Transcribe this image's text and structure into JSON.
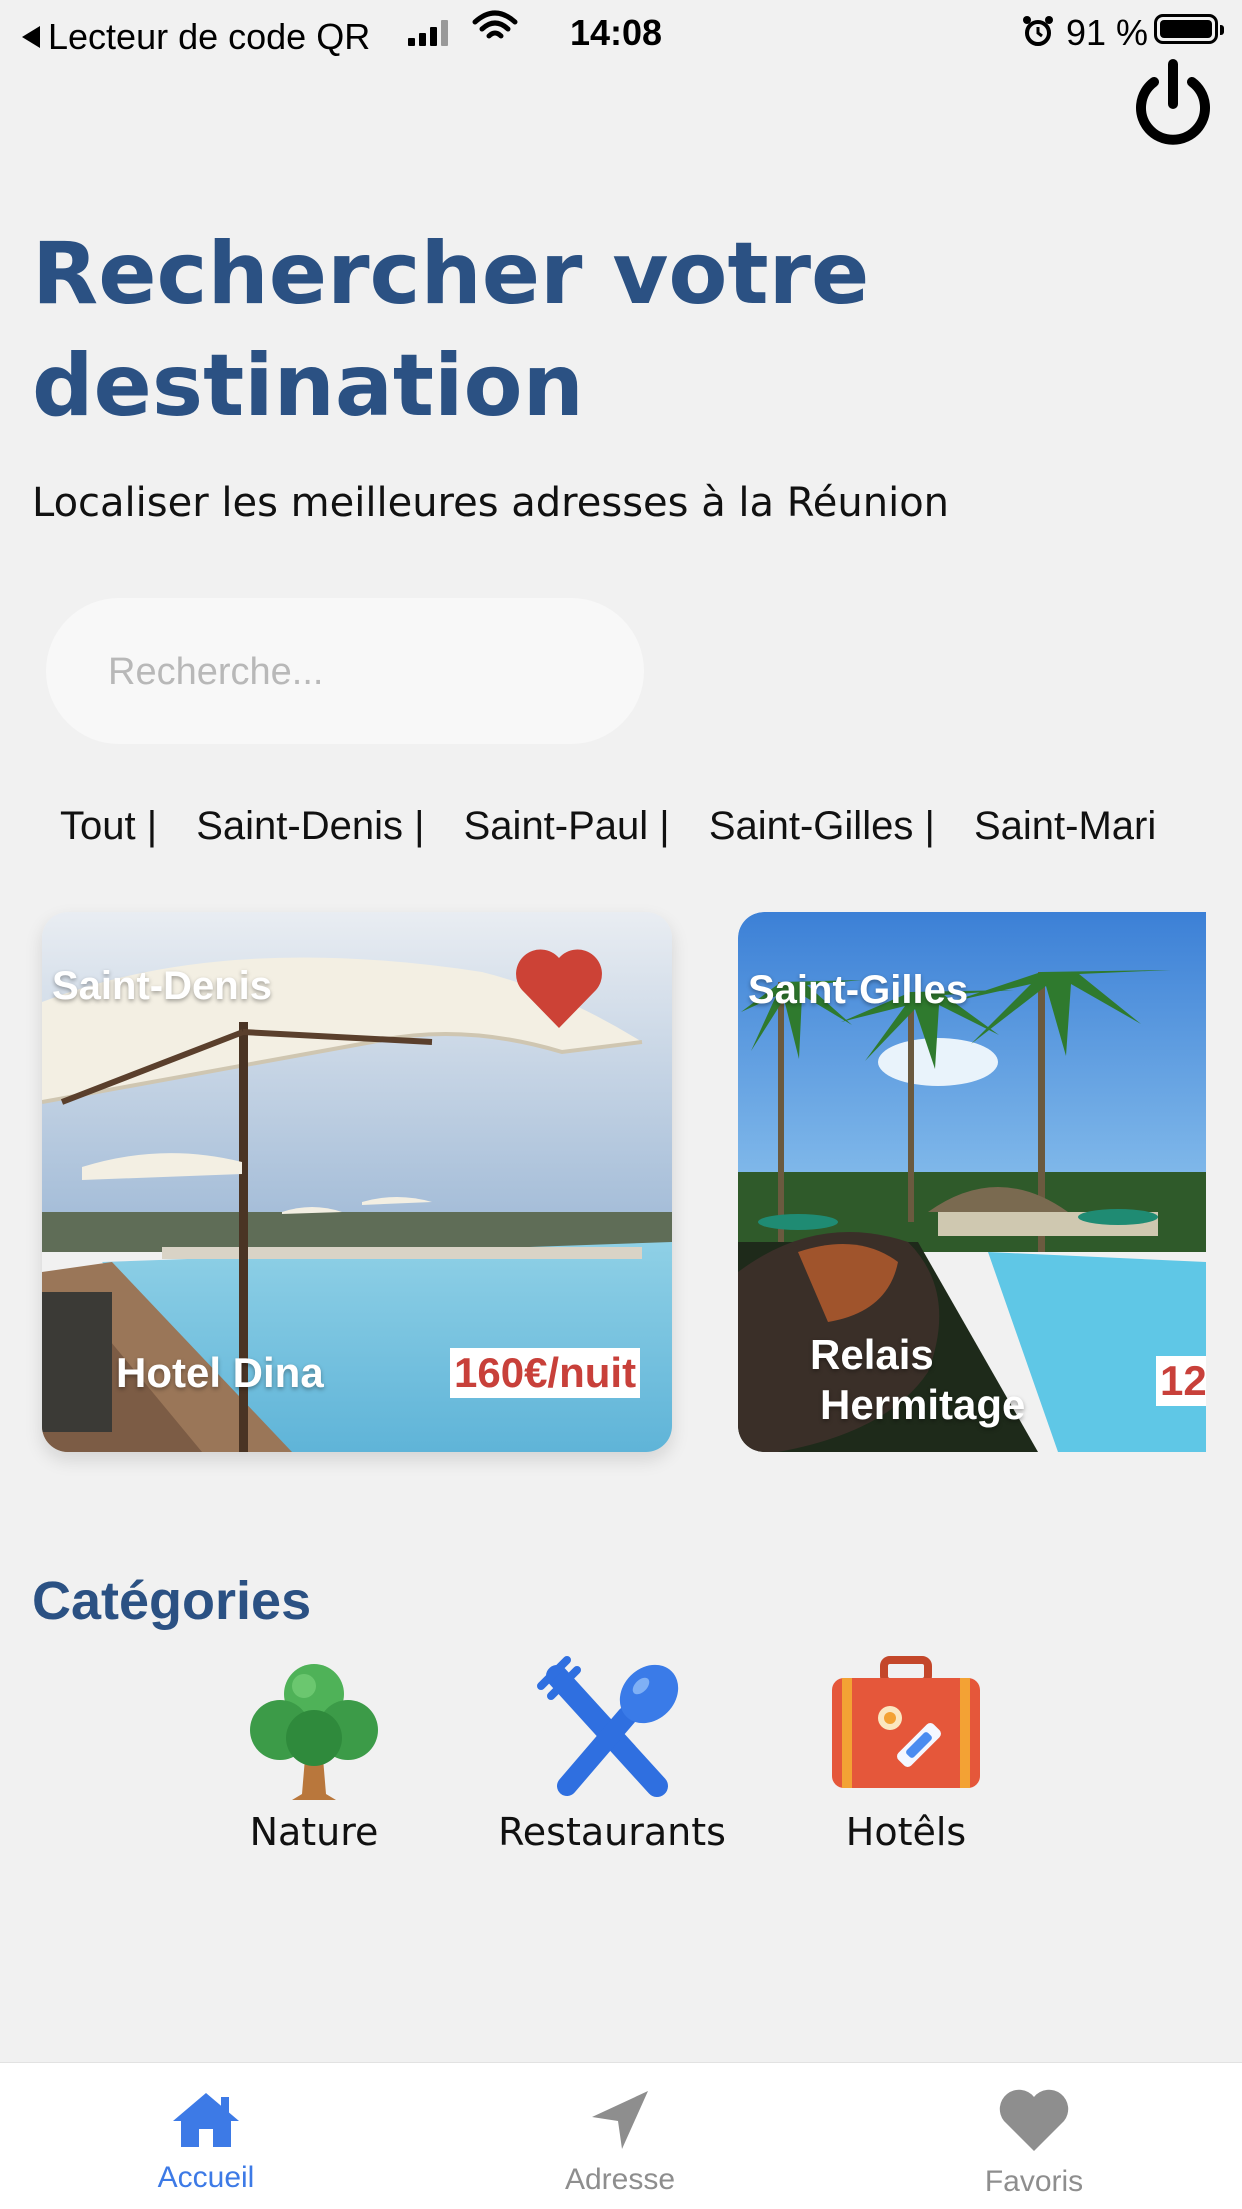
{
  "status_bar": {
    "back_app": "Lecteur de code QR",
    "time": "14:08",
    "battery": "91 %"
  },
  "header": {
    "title": "Rechercher votre destination",
    "subtitle": "Localiser les meilleures adresses à la Réunion"
  },
  "search": {
    "placeholder": "Recherche..."
  },
  "city_filters": [
    "Tout |",
    "Saint-Denis |",
    "Saint-Paul |",
    "Saint-Gilles |",
    "Saint-Mari"
  ],
  "cards": [
    {
      "city": "Saint-Denis",
      "name": "Hotel Dina",
      "price": "160€/nuit",
      "favorite": true
    },
    {
      "city": "Saint-Gilles",
      "name_line1": "Relais",
      "name_line2": "Hermitage",
      "price": "12"
    }
  ],
  "categories": {
    "title": "Catégories",
    "items": [
      {
        "label": "Nature",
        "icon": "tree-icon"
      },
      {
        "label": "Restaurants",
        "icon": "fork-spoon-icon"
      },
      {
        "label": "Hotêls",
        "icon": "suitcase-icon"
      }
    ]
  },
  "tabs": [
    {
      "label": "Accueil",
      "icon": "home-icon",
      "active": true
    },
    {
      "label": "Adresse",
      "icon": "location-arrow-icon",
      "active": false
    },
    {
      "label": "Favoris",
      "icon": "heart-icon",
      "active": false
    }
  ],
  "colors": {
    "title": "#2b5183",
    "active_tab": "#3d7ae6",
    "price": "#c8403a",
    "heart": "#cc4236"
  }
}
